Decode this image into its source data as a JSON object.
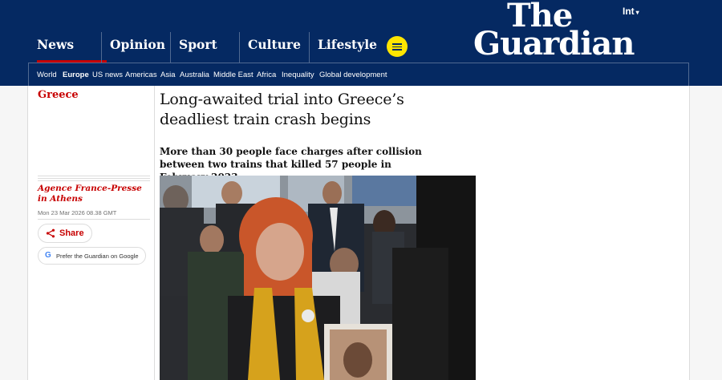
{
  "header": {
    "edition": "Int",
    "logo_line1": "The",
    "logo_line2": "Guardian",
    "pillars": [
      "News",
      "Opinion",
      "Sport",
      "Culture",
      "Lifestyle"
    ],
    "subnav": [
      "World",
      "Europe",
      "US news",
      "Americas",
      "Asia",
      "Australia",
      "Middle East",
      "Africa",
      "Inequality",
      "Global development"
    ]
  },
  "article": {
    "section": "Greece",
    "headline": "Long-awaited trial into Greece’s deadliest train crash begins",
    "standfirst": "More than 30 people face charges after collision between two trains that killed 57 people in February 2023",
    "byline": "Agence France-Presse in Athens",
    "date": "Mon 23 Mar 2026 08.38 GMT",
    "share_label": "Share",
    "google_label": "Prefer the Guardian on Google"
  },
  "colors": {
    "brand": "#052962",
    "news_red": "#c70000",
    "menu_yellow": "#ffe500"
  }
}
